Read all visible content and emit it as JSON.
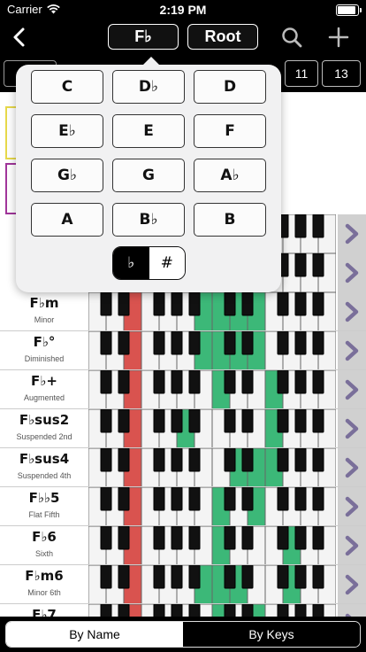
{
  "status": {
    "carrier": "Carrier",
    "time": "2:19 PM",
    "battery_level": 1.0
  },
  "nav": {
    "key_button": "F♭",
    "root_button": "Root"
  },
  "interval_tabs": [
    "11",
    "13"
  ],
  "chords": [
    {
      "name": "F♭m",
      "type": "Minor",
      "red": [
        2
      ],
      "green": [
        6,
        7,
        8,
        9
      ]
    },
    {
      "name": "F♭°",
      "type": "Diminished",
      "red": [
        2
      ],
      "green": [
        6,
        7,
        8,
        9
      ]
    },
    {
      "name": "F♭+",
      "type": "Augmented",
      "red": [
        2
      ],
      "green": [
        7,
        10
      ]
    },
    {
      "name": "F♭sus2",
      "type": "Suspended 2nd",
      "red": [
        2
      ],
      "green": [
        5,
        10
      ]
    },
    {
      "name": "F♭sus4",
      "type": "Suspended 4th",
      "red": [
        2
      ],
      "green": [
        8,
        9,
        10
      ]
    },
    {
      "name": "F♭♭5",
      "type": "Flat Fifth",
      "red": [
        2
      ],
      "green": [
        7,
        9
      ]
    },
    {
      "name": "F♭6",
      "type": "Sixth",
      "red": [
        2
      ],
      "green": [
        7,
        11
      ]
    },
    {
      "name": "F♭m6",
      "type": "Minor 6th",
      "red": [
        2
      ],
      "green": [
        6,
        7,
        8,
        11
      ]
    },
    {
      "name": "F♭7",
      "type": "",
      "red": [
        2
      ],
      "green": [
        7,
        9
      ]
    }
  ],
  "key_picker": {
    "keys": [
      "C",
      "D♭",
      "D",
      "E♭",
      "E",
      "F",
      "G♭",
      "G",
      "A♭",
      "A",
      "B♭",
      "B"
    ],
    "flat_label": "♭",
    "sharp_label": "#",
    "selected_accidental": "flat"
  },
  "bottom_tabs": {
    "by_name": "By Name",
    "by_keys": "By Keys",
    "selected": "by_keys"
  },
  "colors": {
    "root": "#d9534f",
    "interval": "#3cb878",
    "accent": "#7a6f9a"
  }
}
